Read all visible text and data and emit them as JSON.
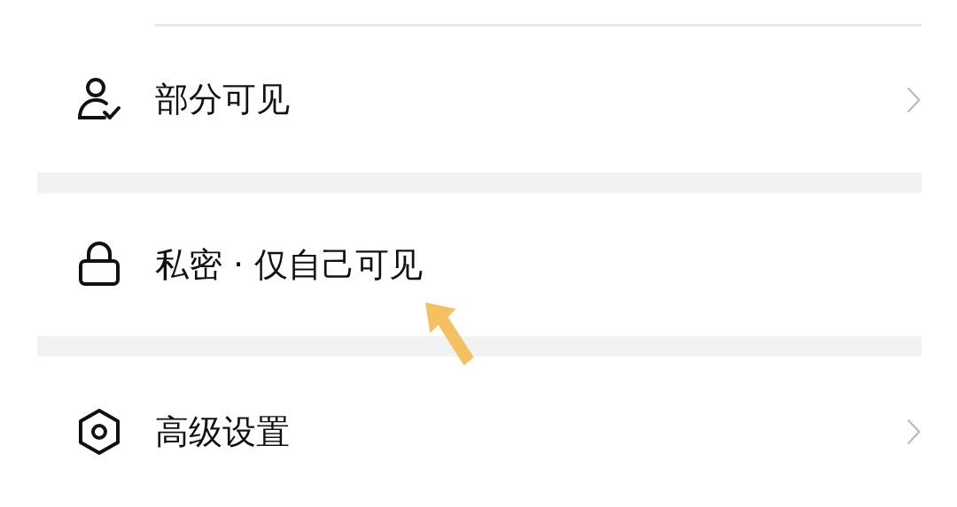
{
  "items": [
    {
      "label": "部分可见",
      "kind": "link"
    },
    {
      "label": "私密 · 仅自己可见",
      "kind": "plain"
    },
    {
      "label": "高级设置",
      "kind": "link"
    }
  ]
}
